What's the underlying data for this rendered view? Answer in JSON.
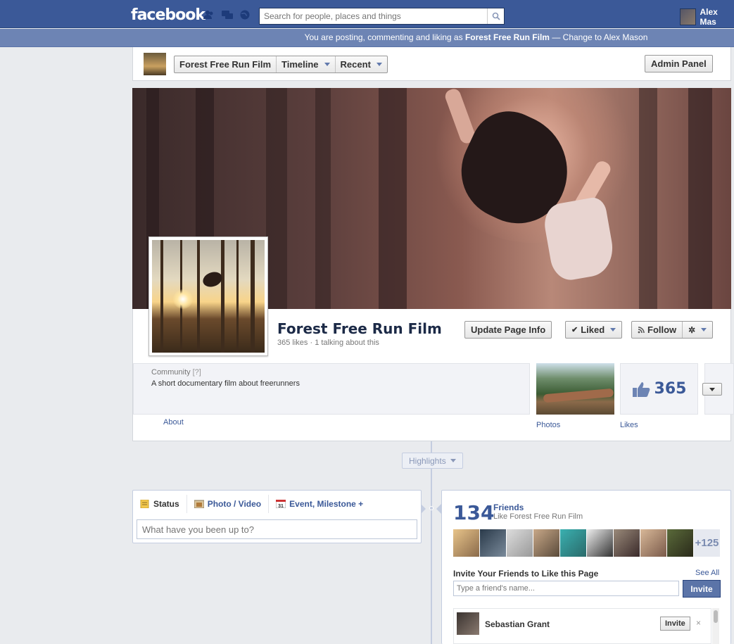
{
  "topbar": {
    "logo": "facebook",
    "search_placeholder": "Search for people, places and things",
    "user_name": "Alex Mas"
  },
  "voice_bar": {
    "prefix": "You are posting, commenting and liking as ",
    "page_name": "Forest Free Run Film",
    "separator": " — ",
    "change_link": "Change to Alex Mason"
  },
  "page_header": {
    "page_button": "Forest Free Run Film",
    "timeline_button": "Timeline",
    "recent_button": "Recent",
    "admin_button": "Admin Panel"
  },
  "profile": {
    "title": "Forest Free Run Film",
    "stats": "365 likes · 1 talking about this",
    "update_button": "Update Page Info",
    "liked_button": "Liked",
    "follow_button": "Follow"
  },
  "about": {
    "category": "Community",
    "help": "[?]",
    "description": "A short documentary film about freerunners",
    "link": "About"
  },
  "tiles": {
    "photos_label": "Photos",
    "likes_count": "365",
    "likes_label": "Likes"
  },
  "timeline": {
    "highlights": "Highlights"
  },
  "composer": {
    "tab_status": "Status",
    "tab_photo": "Photo / Video",
    "tab_event": "Event, Milestone +",
    "placeholder": "What have you been up to?"
  },
  "friends": {
    "count": "134",
    "label": "Friends",
    "sub": "Like Forest Free Run Film",
    "more": "+125",
    "invite_title": "Invite Your Friends to Like this Page",
    "see_all": "See All",
    "invite_placeholder": "Type a friend's name...",
    "invite_button": "Invite",
    "rows": [
      {
        "name": "Sebastian Grant",
        "button": "Invite",
        "remove": "×"
      }
    ]
  },
  "colors": {
    "brand": "#3b5998",
    "voice_bar": "#6d84b4",
    "background": "#e9ebee"
  }
}
